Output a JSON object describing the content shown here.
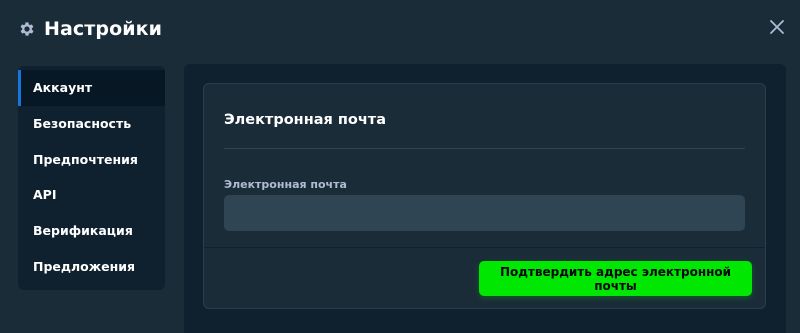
{
  "header": {
    "title": "Настройки",
    "icon": "gear-icon",
    "close_icon": "close-icon"
  },
  "sidebar": {
    "active_index": 0,
    "items": [
      {
        "label": "Аккаунт"
      },
      {
        "label": "Безопасность"
      },
      {
        "label": "Предпочтения"
      },
      {
        "label": "API"
      },
      {
        "label": "Верификация"
      },
      {
        "label": "Предложения"
      }
    ]
  },
  "main": {
    "card_title": "Электронная почта",
    "email_field": {
      "label": "Электронная почта",
      "value": "",
      "placeholder": ""
    },
    "confirm_button_label": "Подтвердить адрес электронной почты"
  },
  "colors": {
    "background": "#1a2c38",
    "sidebar_bg": "#0f212e",
    "accent_blue": "#1475e1",
    "button_green": "#00e701",
    "input_bg": "#2f4553",
    "label_muted": "#b1bad3"
  }
}
